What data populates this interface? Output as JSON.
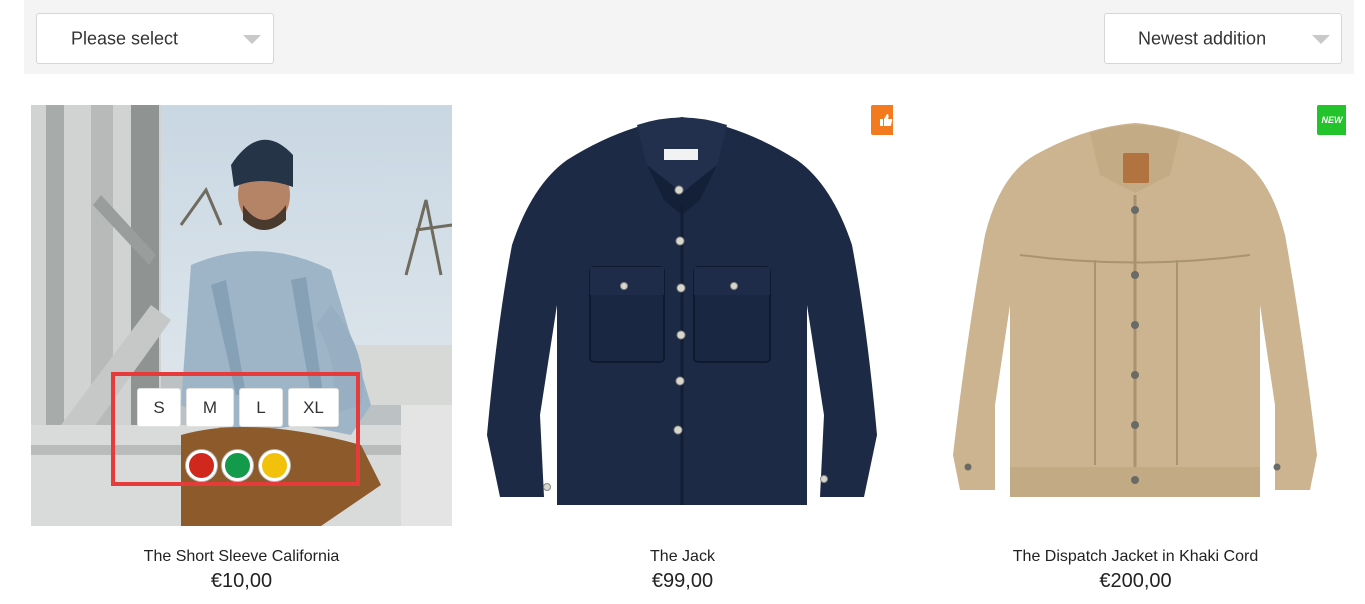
{
  "filters": {
    "category_select": {
      "value": "Please select"
    },
    "sort_select": {
      "value": "Newest addition"
    }
  },
  "products": [
    {
      "title": "The Short Sleeve California",
      "price": "€10,00",
      "image": "man-denim-jacket-photo",
      "sizes": [
        "S",
        "M",
        "L",
        "XL"
      ],
      "colors": [
        "#d0281c",
        "#139a4a",
        "#f2c10b"
      ]
    },
    {
      "title": "The Jack",
      "price": "€99,00",
      "image": "navy-shirt-jacket",
      "badge": {
        "type": "thumbs-up-icon",
        "color": "#f47a20"
      }
    },
    {
      "title": "The Dispatch Jacket in Khaki Cord",
      "price": "€200,00",
      "image": "khaki-cord-jacket",
      "badge": {
        "type": "new",
        "label": "NEW",
        "color": "#22c32b"
      }
    }
  ],
  "colors": {
    "highlight": "#e63b3b"
  }
}
